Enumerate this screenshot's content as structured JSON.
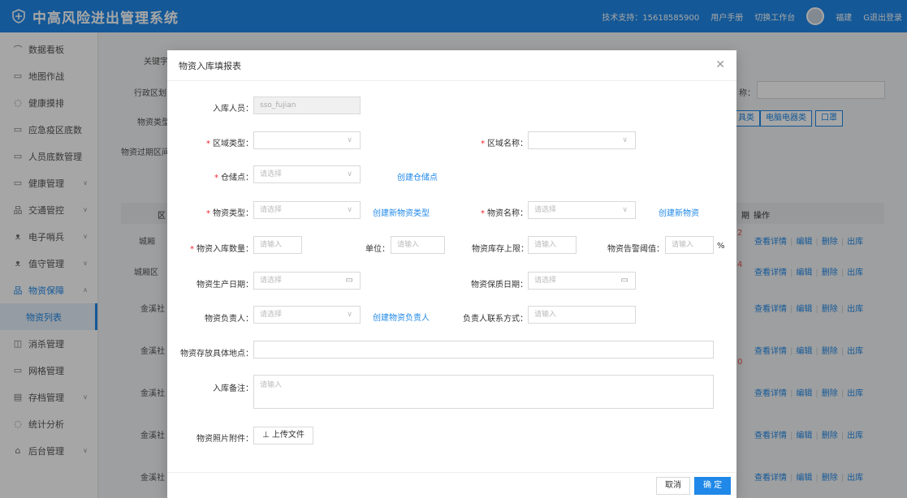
{
  "header": {
    "title": "中高风险进出管理系统",
    "support": "技术支持：15618585900",
    "manual": "用户手册",
    "switch": "切换工作台",
    "user": "福建",
    "logout": "G退出登录"
  },
  "sidebar": {
    "items": [
      {
        "label": "数据看板",
        "icon": "chart-icon"
      },
      {
        "label": "地图作战",
        "icon": "map-icon"
      },
      {
        "label": "健康摸排",
        "icon": "shield-icon"
      },
      {
        "label": "应急疫区底数",
        "icon": "monitor-icon"
      },
      {
        "label": "人员底数管理",
        "icon": "monitor-icon"
      },
      {
        "label": "健康管理",
        "icon": "monitor-icon"
      },
      {
        "label": "交通管控",
        "icon": "network-icon"
      },
      {
        "label": "电子哨兵",
        "icon": "user-group-icon"
      },
      {
        "label": "值守管理",
        "icon": "user-group-icon"
      },
      {
        "label": "物资保障",
        "icon": "network-icon"
      },
      {
        "label": "物资列表",
        "icon": ""
      },
      {
        "label": "消杀管理",
        "icon": "box-icon"
      },
      {
        "label": "网格管理",
        "icon": "monitor-icon"
      },
      {
        "label": "存档管理",
        "icon": "document-icon"
      },
      {
        "label": "统计分析",
        "icon": "shield-icon"
      },
      {
        "label": "后台管理",
        "icon": "building-icon"
      }
    ]
  },
  "bg": {
    "keyword": "关键字",
    "region": "行政区划",
    "type": "物资类型",
    "expire": "物资过期区间",
    "name_suffix": "称：",
    "tags": [
      "具类",
      "电脑电器类",
      "口罩"
    ],
    "col_region": "区",
    "col_period": "期",
    "col_ops": "操作",
    "rows": [
      "城厢",
      "城厢区",
      "金溪社",
      "金溪社",
      "金溪社",
      "金溪社",
      "金溪社"
    ],
    "ops": {
      "view": "查看详情",
      "edit": "编辑",
      "del": "删除",
      "out": "出库"
    },
    "reds": [
      "2",
      "4",
      "0"
    ]
  },
  "modal": {
    "title": "物资入库填报表",
    "person_label": "入库人员：",
    "person_value": "sso_fujian",
    "zone_type_label": "区域类型：",
    "zone_name_label": "区域名称：",
    "warehouse_label": "仓储点：",
    "warehouse_ph": "请选择",
    "create_warehouse": "创建仓储点",
    "mtype_label": "物资类型：",
    "mtype_ph": "请选择",
    "create_mtype": "创建新物资类型",
    "mname_label": "物资名称：",
    "mname_ph": "请选择",
    "create_mname": "创建新物资",
    "qty_label": "物资入库数量：",
    "qty_ph": "请输入",
    "unit_label": "单位：",
    "unit_ph": "请输入",
    "max_label": "物资库存上限：",
    "max_ph": "请输入",
    "alert_label": "物资告警阈值：",
    "alert_ph": "请输入",
    "pct": "%",
    "prod_label": "物资生产日期：",
    "prod_ph": "请选择",
    "shelf_label": "物资保质日期：",
    "shelf_ph": "请选择",
    "owner_label": "物资负责人：",
    "owner_ph": "请选择",
    "create_owner": "创建物资负责人",
    "contact_label": "负责人联系方式：",
    "contact_ph": "请输入",
    "location_label": "物资存放具体地点：",
    "remark_label": "入库备注：",
    "remark_ph": "请输入",
    "photo_label": "物资照片附件：",
    "upload": "上传文件",
    "cancel": "取消",
    "ok": "确 定"
  }
}
